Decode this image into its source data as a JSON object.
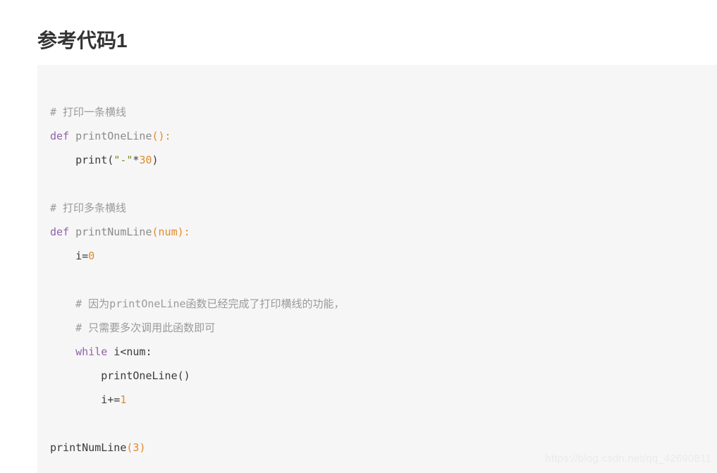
{
  "page": {
    "title": "参考代码1",
    "background_color": "#ffffff"
  },
  "code_block": {
    "background_color": "#f7f6f7",
    "language": "python",
    "syntax_colors": {
      "comment": "#9a9a9a",
      "keyword": "#8e63a8",
      "function_name": "#8b8b8b",
      "punctuation": "#e08b2a",
      "parameter": "#e08b2a",
      "number": "#e08b2a",
      "string": "#7d8c2b",
      "plain": "#3a3a3a"
    },
    "lines": [
      {
        "indent": 0,
        "tokens": [
          {
            "t": "comment",
            "v": "# 打印一条横线"
          }
        ]
      },
      {
        "indent": 0,
        "tokens": [
          {
            "t": "keyword",
            "v": "def"
          },
          {
            "t": "plain",
            "v": " "
          },
          {
            "t": "funcname",
            "v": "printOneLine"
          },
          {
            "t": "punct",
            "v": "():"
          }
        ]
      },
      {
        "indent": 1,
        "tokens": [
          {
            "t": "plain",
            "v": "print("
          },
          {
            "t": "string",
            "v": "\"-\""
          },
          {
            "t": "plain",
            "v": "*"
          },
          {
            "t": "number",
            "v": "30"
          },
          {
            "t": "plain",
            "v": ")"
          }
        ]
      },
      {
        "indent": 0,
        "tokens": []
      },
      {
        "indent": 0,
        "tokens": [
          {
            "t": "comment",
            "v": "# 打印多条横线"
          }
        ]
      },
      {
        "indent": 0,
        "tokens": [
          {
            "t": "keyword",
            "v": "def"
          },
          {
            "t": "plain",
            "v": " "
          },
          {
            "t": "funcname",
            "v": "printNumLine"
          },
          {
            "t": "punct",
            "v": "("
          },
          {
            "t": "param",
            "v": "num"
          },
          {
            "t": "punct",
            "v": "):"
          }
        ]
      },
      {
        "indent": 1,
        "tokens": [
          {
            "t": "plain",
            "v": "i="
          },
          {
            "t": "number",
            "v": "0"
          }
        ]
      },
      {
        "indent": 0,
        "tokens": []
      },
      {
        "indent": 1,
        "tokens": [
          {
            "t": "comment",
            "v": "# 因为printOneLine函数已经完成了打印横线的功能，"
          }
        ]
      },
      {
        "indent": 1,
        "tokens": [
          {
            "t": "comment",
            "v": "# 只需要多次调用此函数即可"
          }
        ]
      },
      {
        "indent": 1,
        "tokens": [
          {
            "t": "keyword",
            "v": "while"
          },
          {
            "t": "plain",
            "v": " i<num:"
          }
        ]
      },
      {
        "indent": 2,
        "tokens": [
          {
            "t": "plain",
            "v": "printOneLine()"
          }
        ]
      },
      {
        "indent": 2,
        "tokens": [
          {
            "t": "plain",
            "v": "i+="
          },
          {
            "t": "number",
            "v": "1"
          }
        ]
      },
      {
        "indent": 0,
        "tokens": []
      },
      {
        "indent": 0,
        "tokens": [
          {
            "t": "plain",
            "v": "printNumLine"
          },
          {
            "t": "punct",
            "v": "("
          },
          {
            "t": "number",
            "v": "3"
          },
          {
            "t": "punct",
            "v": ")"
          }
        ]
      }
    ]
  },
  "watermark": {
    "text": "https://blog.csdn.net/qq_42690811"
  }
}
